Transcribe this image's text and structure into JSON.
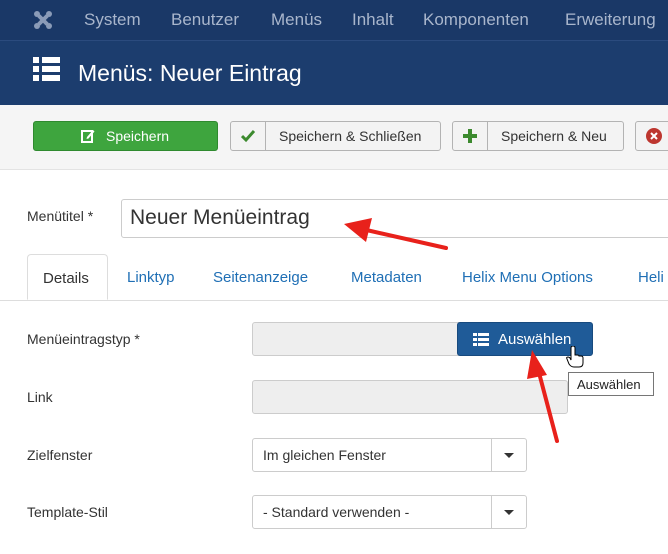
{
  "topnav": {
    "items": [
      "System",
      "Benutzer",
      "Menüs",
      "Inhalt",
      "Komponenten",
      "Erweiterung"
    ]
  },
  "header": {
    "title": "Menüs: Neuer Eintrag",
    "icon": "list-icon"
  },
  "toolbar": {
    "save_label": "Speichern",
    "save_close_label": "Speichern & Schließen",
    "save_new_label": "Speichern & Neu",
    "colors": {
      "save_bg": "#3ea53e",
      "check": "#3c8a2e",
      "plus": "#3c8a2e",
      "cancel": "#bd362f"
    }
  },
  "form": {
    "title_label": "Menütitel *",
    "title_value": "Neuer Menüeintrag"
  },
  "tabs": [
    "Details",
    "Linktyp",
    "Seitenanzeige",
    "Metadaten",
    "Helix Menu Options",
    "Heli"
  ],
  "details": {
    "type_label": "Menüeintragstyp *",
    "select_button": "Auswählen",
    "tooltip": "Auswählen",
    "link_label": "Link",
    "target_label": "Zielfenster",
    "target_value": "Im gleichen Fenster",
    "style_label": "Template-Stil",
    "style_value": "- Standard verwenden -"
  },
  "colors": {
    "nav_bg": "#1a3867",
    "header_bg": "#1c3d6e",
    "primary_button": "#1f5b98",
    "annotation_arrow": "#e8211b"
  }
}
